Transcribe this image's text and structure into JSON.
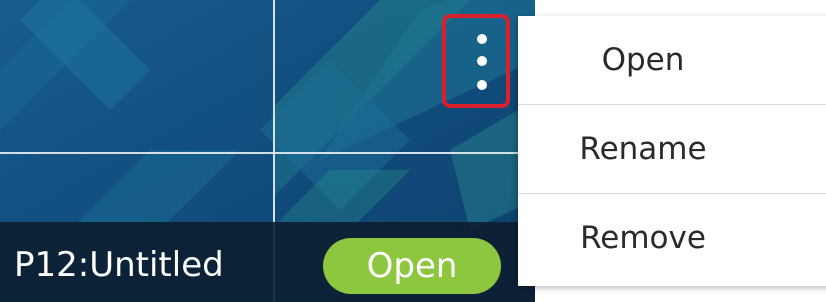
{
  "project_card": {
    "name": "P12:Untitled",
    "open_button_label": "Open",
    "more_options_icon": "vertical-dots-icon"
  },
  "context_menu": {
    "items": [
      {
        "label": "Open"
      },
      {
        "label": "Rename"
      },
      {
        "label": "Remove"
      }
    ]
  },
  "colors": {
    "thumbnail_background": "#0f4a7d",
    "open_button": "#8dc63f",
    "highlight_border": "#d8212d",
    "menu_background": "#ffffff"
  }
}
